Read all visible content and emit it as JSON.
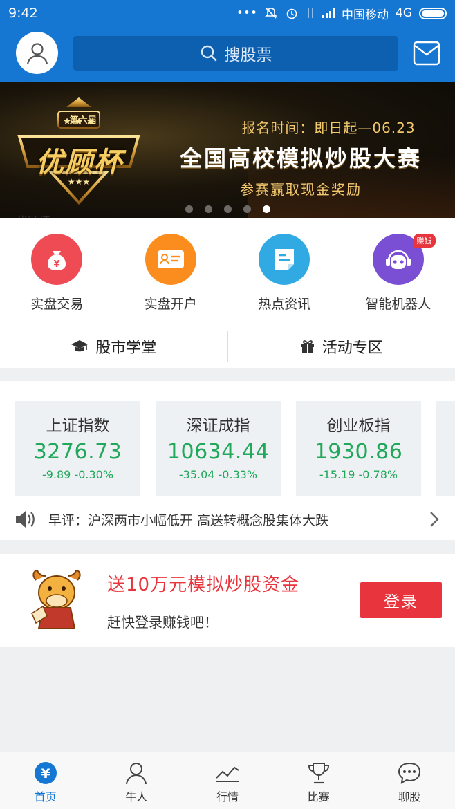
{
  "status_bar": {
    "time": "9:42",
    "carrier": "中国移动",
    "network": "4G",
    "dots": "•••"
  },
  "header": {
    "search_placeholder": "搜股票"
  },
  "banner": {
    "badge_top": "第六届",
    "badge_main": "优顾杯",
    "line1": "报名时间：即日起—06.23",
    "line2": "全国高校模拟炒股大赛",
    "line3": "参赛赢取现金奖励",
    "dot_count": 5,
    "active_dot": 4
  },
  "quick_menu": [
    {
      "label": "实盘交易",
      "icon": "money-bag-icon",
      "color": "#ef4b55"
    },
    {
      "label": "实盘开户",
      "icon": "account-card-icon",
      "color": "#fb8c1e"
    },
    {
      "label": "热点资讯",
      "icon": "news-icon",
      "color": "#31a9e3"
    },
    {
      "label": "智能机器人",
      "icon": "robot-icon",
      "color": "#7b4fd4",
      "badge": "赚钱"
    }
  ],
  "links": [
    {
      "label": "股市学堂",
      "icon": "graduation-cap-icon"
    },
    {
      "label": "活动专区",
      "icon": "gift-icon"
    }
  ],
  "indices": [
    {
      "name": "上证指数",
      "value": "3276.73",
      "change": "-9.89  -0.30%"
    },
    {
      "name": "深证成指",
      "value": "10634.44",
      "change": "-35.04  -0.33%"
    },
    {
      "name": "创业板指",
      "value": "1930.86",
      "change": "-15.19  -0.78%"
    }
  ],
  "news": {
    "text": "早评：沪深两市小幅低开 高送转概念股集体大跌"
  },
  "promo": {
    "title": "送10万元模拟炒股资金",
    "subtitle": "赶快登录赚钱吧！",
    "button": "登录"
  },
  "tabs": [
    {
      "label": "首页",
      "icon": "home-yuan-icon",
      "active": true
    },
    {
      "label": "牛人",
      "icon": "person-icon"
    },
    {
      "label": "行情",
      "icon": "chart-line-icon"
    },
    {
      "label": "比赛",
      "icon": "trophy-icon"
    },
    {
      "label": "聊股",
      "icon": "chat-icon"
    }
  ],
  "colors": {
    "brand": "#1677d2",
    "down": "#22a85a",
    "accent": "#e8353d"
  }
}
